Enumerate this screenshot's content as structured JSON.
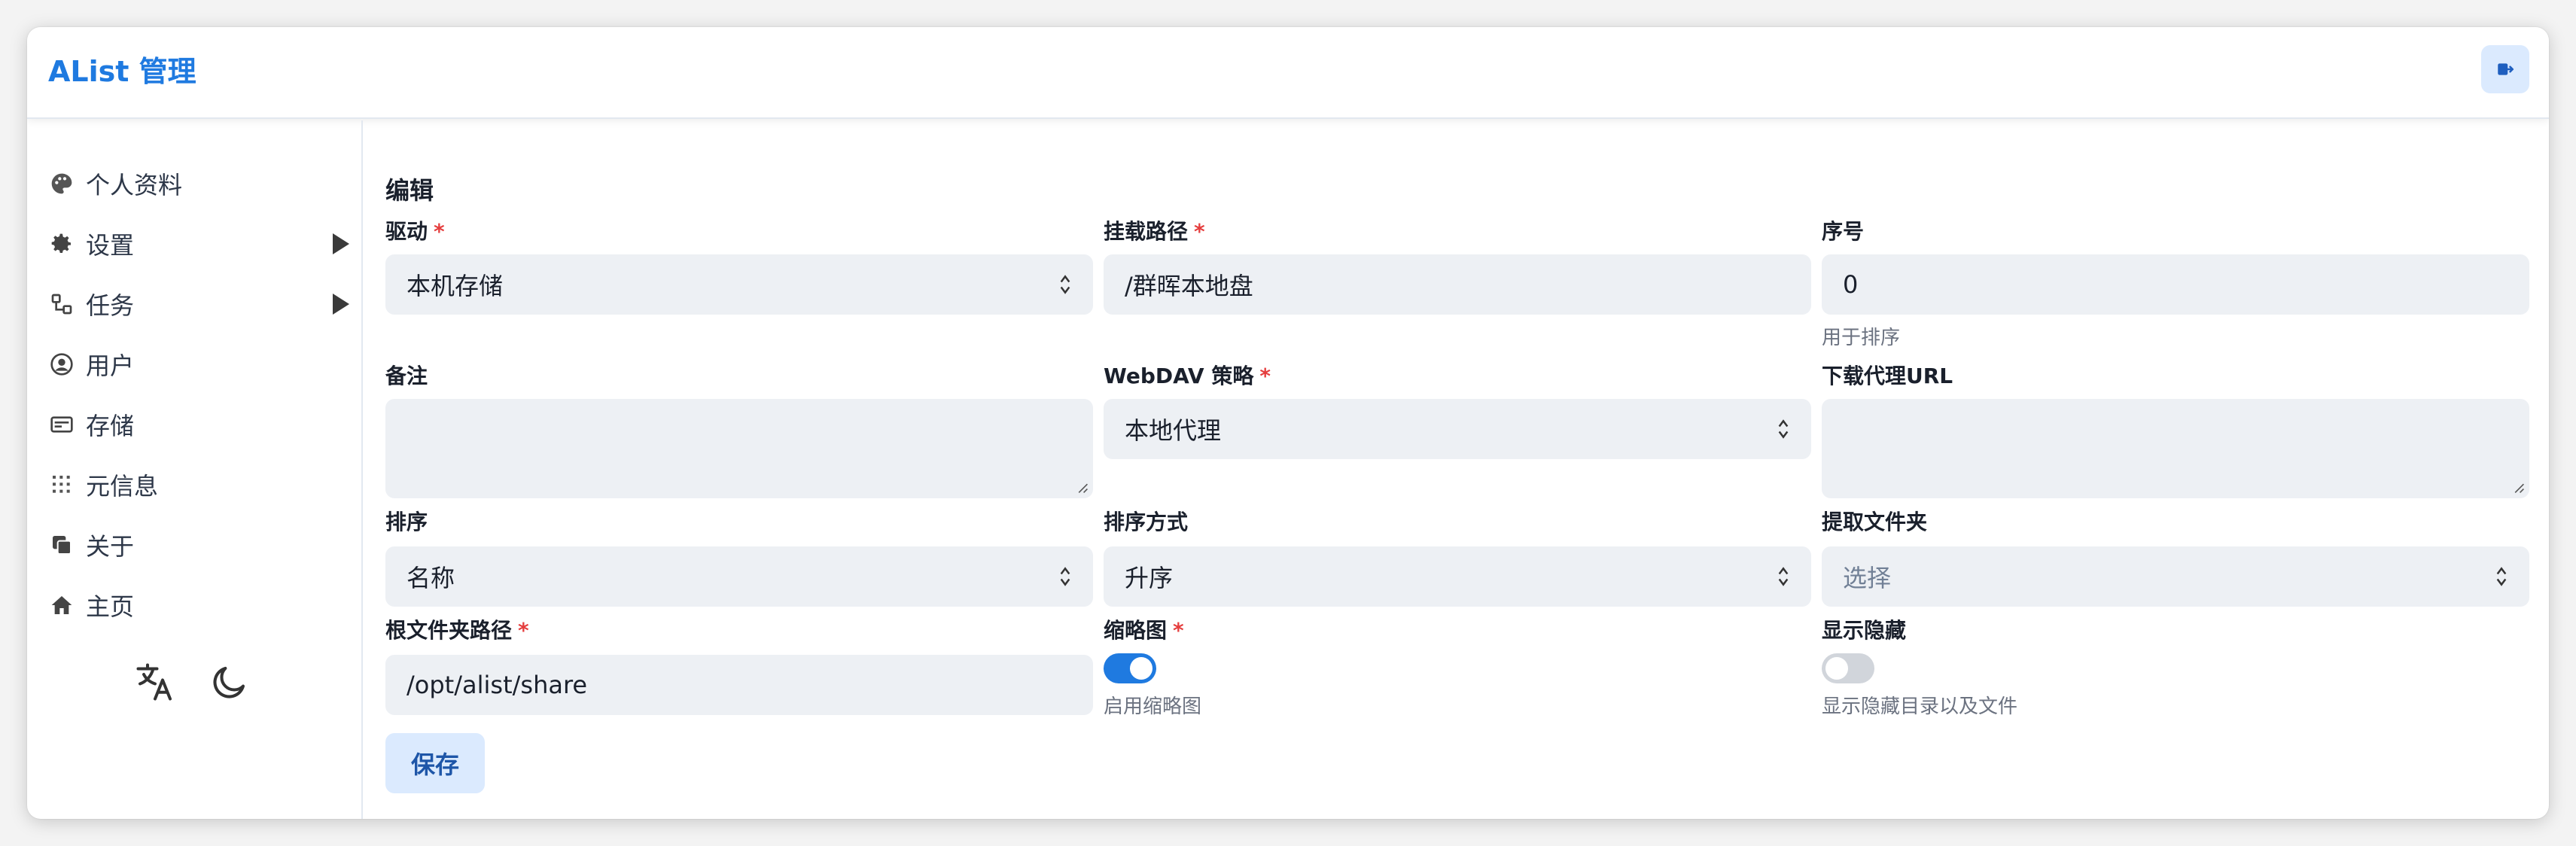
{
  "app": {
    "title": "AList 管理"
  },
  "header": {
    "logout_icon": "logout-icon"
  },
  "sidebar": {
    "items": [
      {
        "label": "个人资料",
        "icon": "palette-icon"
      },
      {
        "label": "设置",
        "icon": "gear-icon",
        "expandable": true
      },
      {
        "label": "任务",
        "icon": "tasks-icon",
        "expandable": true
      },
      {
        "label": "用户",
        "icon": "user-circle-icon"
      },
      {
        "label": "存储",
        "icon": "storage-icon"
      },
      {
        "label": "元信息",
        "icon": "meta-icon"
      },
      {
        "label": "关于",
        "icon": "copy-icon"
      },
      {
        "label": "主页",
        "icon": "home-icon"
      }
    ],
    "footer": {
      "language_icon": "translate-icon",
      "theme_icon": "moon-icon"
    }
  },
  "form": {
    "title": "编辑",
    "driver": {
      "label": "驱动",
      "value": "本机存储",
      "required": "*"
    },
    "mount_path": {
      "label": "挂载路径",
      "value": "/群晖本地盘",
      "required": "*"
    },
    "order": {
      "label": "序号",
      "value": "0",
      "helper": "用于排序"
    },
    "remark": {
      "label": "备注",
      "value": ""
    },
    "webdav_policy": {
      "label": "WebDAV 策略",
      "value": "本地代理",
      "required": "*"
    },
    "download_proxy_url": {
      "label": "下载代理URL",
      "value": ""
    },
    "order_by": {
      "label": "排序",
      "value": "名称"
    },
    "order_direction": {
      "label": "排序方式",
      "value": "升序"
    },
    "extract_folder": {
      "label": "提取文件夹",
      "placeholder": "选择"
    },
    "root_folder_path": {
      "label": "根文件夹路径",
      "value": "/opt/alist/share",
      "required": "*"
    },
    "thumbnail": {
      "label": "缩略图",
      "required": "*",
      "enabled": true,
      "helper": "启用缩略图"
    },
    "show_hidden": {
      "label": "显示隐藏",
      "enabled": false,
      "helper": "显示隐藏目录以及文件"
    },
    "save_label": "保存"
  },
  "colors": {
    "accent": "#1f7ae0",
    "required": "#e53e3e",
    "input_bg": "#edf0f4",
    "button_bg": "#dbeafe"
  }
}
